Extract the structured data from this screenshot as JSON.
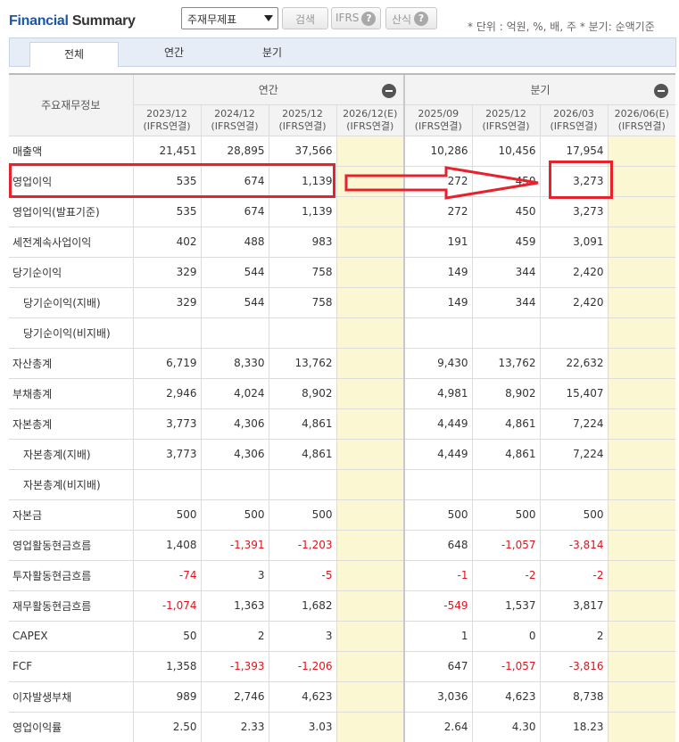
{
  "header": {
    "title_part1": "Financial",
    "title_part2": "Summary",
    "select_value": "주재무제표",
    "search_label": "검색",
    "ifrs_label": "IFRS",
    "formula_label": "산식",
    "help_glyph": "?",
    "unit_note": "* 단위 : 억원, %, 배, 주    * 분기: 순액기준"
  },
  "tabs": [
    "전체",
    "연간",
    "분기"
  ],
  "table": {
    "corner_label": "주요재무정보",
    "group_annual": "연간",
    "group_quarter": "분기",
    "periods": [
      {
        "date": "2023/12",
        "basis": "(IFRS연결)"
      },
      {
        "date": "2024/12",
        "basis": "(IFRS연결)"
      },
      {
        "date": "2025/12",
        "basis": "(IFRS연결)"
      },
      {
        "date": "2026/12(E)",
        "basis": "(IFRS연결)"
      },
      {
        "date": "2025/09",
        "basis": "(IFRS연결)"
      },
      {
        "date": "2025/12",
        "basis": "(IFRS연결)"
      },
      {
        "date": "2026/03",
        "basis": "(IFRS연결)"
      },
      {
        "date": "2026/06(E)",
        "basis": "(IFRS연결)"
      }
    ],
    "rows": [
      {
        "label": "매출액",
        "sub": false,
        "values": [
          "21,451",
          "28,895",
          "37,566",
          "",
          "10,286",
          "10,456",
          "17,954",
          ""
        ]
      },
      {
        "label": "영업이익",
        "sub": false,
        "values": [
          "535",
          "674",
          "1,139",
          "",
          "272",
          "450",
          "3,273",
          ""
        ]
      },
      {
        "label": "영업이익(발표기준)",
        "sub": false,
        "values": [
          "535",
          "674",
          "1,139",
          "",
          "272",
          "450",
          "3,273",
          ""
        ]
      },
      {
        "label": "세전계속사업이익",
        "sub": false,
        "values": [
          "402",
          "488",
          "983",
          "",
          "191",
          "459",
          "3,091",
          ""
        ]
      },
      {
        "label": "당기순이익",
        "sub": false,
        "values": [
          "329",
          "544",
          "758",
          "",
          "149",
          "344",
          "2,420",
          ""
        ]
      },
      {
        "label": "당기순이익(지배)",
        "sub": true,
        "values": [
          "329",
          "544",
          "758",
          "",
          "149",
          "344",
          "2,420",
          ""
        ]
      },
      {
        "label": "당기순이익(비지배)",
        "sub": true,
        "values": [
          "",
          "",
          "",
          "",
          "",
          "",
          "",
          ""
        ]
      },
      {
        "label": "자산총계",
        "sub": false,
        "values": [
          "6,719",
          "8,330",
          "13,762",
          "",
          "9,430",
          "13,762",
          "22,632",
          ""
        ]
      },
      {
        "label": "부채총계",
        "sub": false,
        "values": [
          "2,946",
          "4,024",
          "8,902",
          "",
          "4,981",
          "8,902",
          "15,407",
          ""
        ]
      },
      {
        "label": "자본총계",
        "sub": false,
        "values": [
          "3,773",
          "4,306",
          "4,861",
          "",
          "4,449",
          "4,861",
          "7,224",
          ""
        ]
      },
      {
        "label": "자본총계(지배)",
        "sub": true,
        "values": [
          "3,773",
          "4,306",
          "4,861",
          "",
          "4,449",
          "4,861",
          "7,224",
          ""
        ]
      },
      {
        "label": "자본총계(비지배)",
        "sub": true,
        "values": [
          "",
          "",
          "",
          "",
          "",
          "",
          "",
          ""
        ]
      },
      {
        "label": "자본금",
        "sub": false,
        "values": [
          "500",
          "500",
          "500",
          "",
          "500",
          "500",
          "500",
          ""
        ]
      },
      {
        "label": "영업활동현금흐름",
        "sub": false,
        "values": [
          "1,408",
          "-1,391",
          "-1,203",
          "",
          "648",
          "-1,057",
          "-3,814",
          ""
        ]
      },
      {
        "label": "투자활동현금흐름",
        "sub": false,
        "values": [
          "-74",
          "3",
          "-5",
          "",
          "-1",
          "-2",
          "-2",
          ""
        ]
      },
      {
        "label": "재무활동현금흐름",
        "sub": false,
        "values": [
          "-1,074",
          "1,363",
          "1,682",
          "",
          "-549",
          "1,537",
          "3,817",
          ""
        ]
      },
      {
        "label": "CAPEX",
        "sub": false,
        "values": [
          "50",
          "2",
          "3",
          "",
          "1",
          "0",
          "2",
          ""
        ]
      },
      {
        "label": "FCF",
        "sub": false,
        "values": [
          "1,358",
          "-1,393",
          "-1,206",
          "",
          "647",
          "-1,057",
          "-3,816",
          ""
        ]
      },
      {
        "label": "이자발생부채",
        "sub": false,
        "values": [
          "989",
          "2,746",
          "4,623",
          "",
          "3,036",
          "4,623",
          "8,738",
          ""
        ]
      },
      {
        "label": "영업이익률",
        "sub": false,
        "values": [
          "2.50",
          "2.33",
          "3.03",
          "",
          "2.64",
          "4.30",
          "18.23",
          ""
        ]
      }
    ]
  },
  "colors": {
    "accent": "#1b56a8",
    "negative": "#e0141e",
    "estimate_bg": "#fbf7d2",
    "highlight": "#e8222c"
  }
}
